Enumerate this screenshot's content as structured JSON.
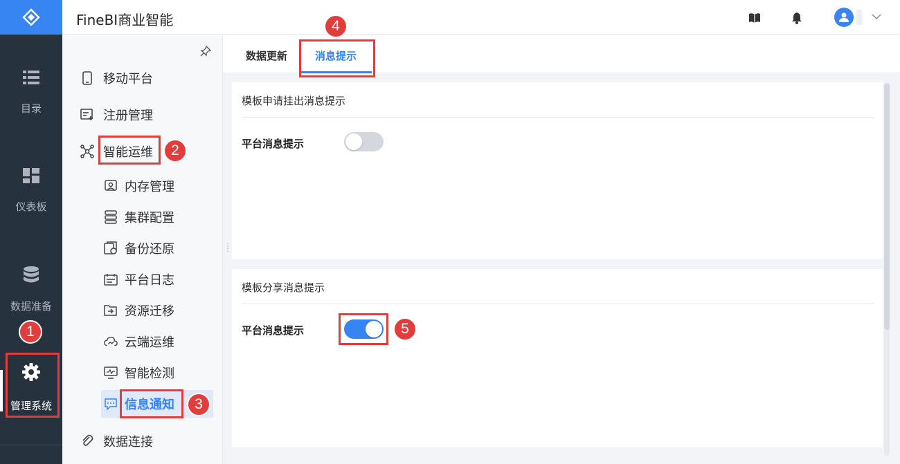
{
  "app": {
    "title": "FineBI商业智能"
  },
  "rail": {
    "items": [
      {
        "label": "目录",
        "icon": "list-icon"
      },
      {
        "label": "仪表板",
        "icon": "dashboard-icon"
      },
      {
        "label": "数据准备",
        "icon": "database-icon"
      },
      {
        "label": "管理系统",
        "icon": "gear-icon",
        "active": true
      }
    ]
  },
  "sidebar": {
    "items": [
      {
        "label": "移动平台",
        "icon": "mobile-icon"
      },
      {
        "label": "注册管理",
        "icon": "register-icon"
      },
      {
        "label": "智能运维",
        "icon": "network-icon"
      },
      {
        "label": "数据连接",
        "icon": "link-icon"
      }
    ],
    "sub_items": [
      {
        "label": "内存管理",
        "icon": "memory-icon"
      },
      {
        "label": "集群配置",
        "icon": "cluster-icon"
      },
      {
        "label": "备份还原",
        "icon": "backup-icon"
      },
      {
        "label": "平台日志",
        "icon": "log-icon"
      },
      {
        "label": "资源迁移",
        "icon": "migrate-icon"
      },
      {
        "label": "云端运维",
        "icon": "cloud-icon"
      },
      {
        "label": "智能检测",
        "icon": "monitor-icon"
      },
      {
        "label": "信息通知",
        "icon": "message-icon",
        "selected": true
      }
    ]
  },
  "tabs": [
    {
      "label": "数据更新",
      "active": false
    },
    {
      "label": "消息提示",
      "active": true
    }
  ],
  "sections": [
    {
      "title": "模板申请挂出消息提示",
      "row_label": "平台消息提示",
      "toggle_on": false
    },
    {
      "title": "模板分享消息提示",
      "row_label": "平台消息提示",
      "toggle_on": true
    }
  ],
  "annotations": [
    "1",
    "2",
    "3",
    "4",
    "5"
  ],
  "colors": {
    "accent": "#3685f2",
    "rail_bg": "#27323f",
    "highlight": "#e23d3d"
  }
}
